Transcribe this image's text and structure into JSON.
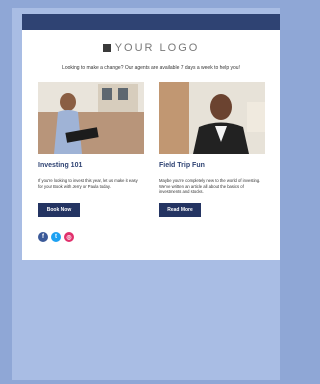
{
  "header": {
    "logo_text": "YOUR LOGO",
    "tagline": "Looking to make a change? Our agents are available 7 days a week to help you!"
  },
  "columns": [
    {
      "title": "Investing 101",
      "body": "If you're looking to invest this year, let us make it easy for you! Book with Jerry or Paula today.",
      "button": "Book Now"
    },
    {
      "title": "Field Trip Fun",
      "body": "Maybe you're completely new to the world of investing. We've written an article all about the basics of investments and stocks.",
      "button": "Read More"
    }
  ],
  "social": {
    "icons": [
      "facebook-icon",
      "twitter-icon",
      "instagram-icon"
    ],
    "colors": [
      "#3b5998",
      "#1da1f2",
      "#e1306c"
    ]
  }
}
